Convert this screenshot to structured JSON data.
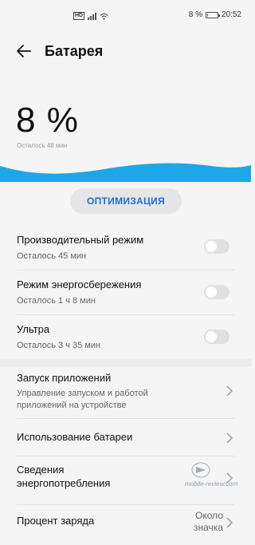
{
  "status_bar": {
    "left_badge": "HD",
    "battery_percent": "8 %",
    "battery_level": 0.08,
    "time": "20:52"
  },
  "header": {
    "title": "Батарея"
  },
  "battery": {
    "percent": "8 %",
    "remaining": "Осталось 48 мин"
  },
  "optimize": {
    "label": "ОПТИМИЗАЦИЯ"
  },
  "modes": [
    {
      "title": "Производительный режим",
      "subtitle": "Осталось 45 мин",
      "enabled": false
    },
    {
      "title": "Режим энергосбережения",
      "subtitle": "Осталось 1 ч 8 мин",
      "enabled": false
    },
    {
      "title": "Ультра",
      "subtitle": "Осталось 3 ч 35 мин",
      "enabled": false
    }
  ],
  "menu": [
    {
      "title": "Запуск приложений",
      "subtitle_line1": "Управление запуском и работой",
      "subtitle_line2": "приложений на устройстве"
    },
    {
      "title": "Использование батареи"
    },
    {
      "title_line1": "Сведения",
      "title_line2": "энергопотребления"
    },
    {
      "title": "Процент заряда",
      "value_line1": "Около",
      "value_line2": "значка"
    }
  ],
  "watermark": "mobile-review.com",
  "colors": {
    "accent": "#1e6fd9",
    "wave": "#1ea7e8",
    "background": "#f5f5f5"
  }
}
